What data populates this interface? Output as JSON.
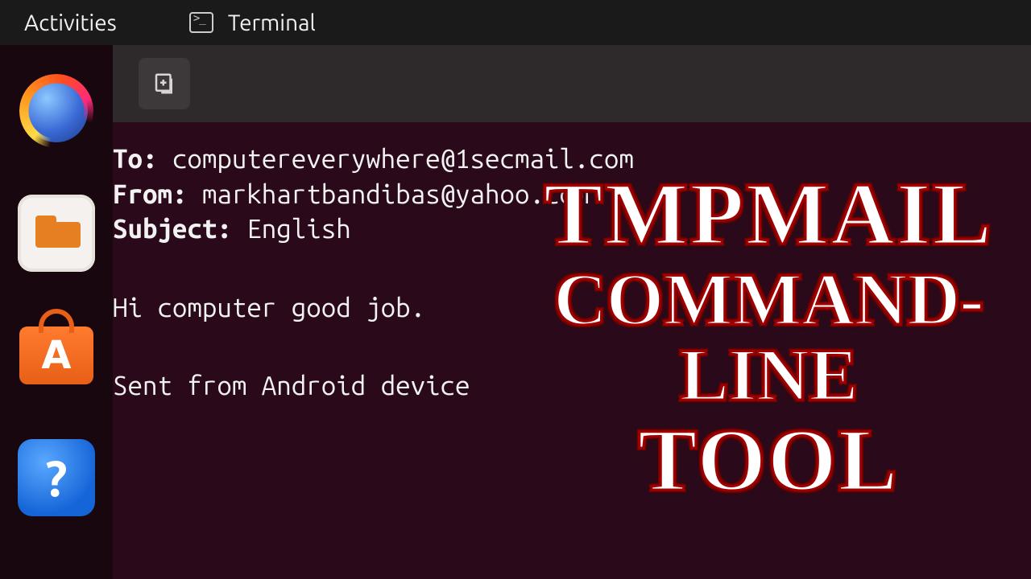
{
  "topbar": {
    "activities": "Activities",
    "app_label": "Terminal"
  },
  "dock": {
    "firefox": "firefox",
    "files": "files",
    "software": "ubuntu-software",
    "software_letter": "A",
    "help": "help",
    "help_symbol": "?"
  },
  "tabbar": {
    "newtab_title": "New Tab"
  },
  "mail": {
    "to_label": "To:",
    "to_value": "computereverywhere@1secmail.com",
    "from_label": "From:",
    "from_value": "markhartbandibas@yahoo.com",
    "subject_label": "Subject:",
    "subject_value": "English",
    "body_line1": "Hi computer good job.",
    "body_line2": "Sent from Android device"
  },
  "overlay": {
    "line1": "TMPMAIL",
    "line2": "COMMAND-LINE",
    "line3": "TOOL"
  }
}
